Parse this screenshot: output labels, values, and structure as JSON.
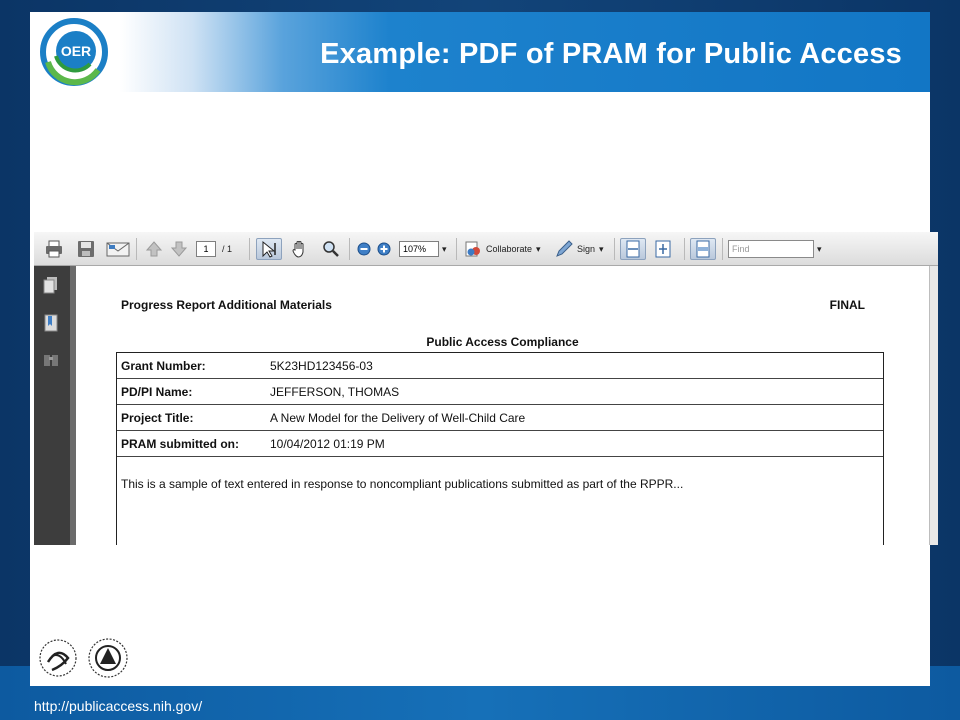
{
  "slide": {
    "title": "Example: PDF of PRAM for Public Access",
    "logo_text": "OER",
    "url": "http://publicaccess.nih.gov/"
  },
  "viewer": {
    "page_current": "1",
    "page_total": "/ 1",
    "zoom": "107%",
    "collaborate_label": "Collaborate",
    "sign_label": "Sign",
    "find_placeholder": "Find",
    "icons": [
      "print-icon",
      "save-icon",
      "email-icon",
      "prev-page-icon",
      "next-page-icon",
      "select-tool-icon",
      "hand-tool-icon",
      "zoom-tool-icon",
      "zoom-out-icon",
      "zoom-in-icon",
      "collaborate-icon",
      "sign-pen-icon",
      "fit-width-icon",
      "fit-page-icon",
      "print-screen-icon"
    ]
  },
  "document": {
    "header_left": "Progress Report Additional Materials",
    "header_right": "FINAL",
    "subtitle": "Public Access Compliance",
    "rows": [
      {
        "label": "Grant Number:",
        "value": "5K23HD123456-03"
      },
      {
        "label": "PD/PI Name:",
        "value": "JEFFERSON, THOMAS"
      },
      {
        "label": "Project Title:",
        "value": "A New Model for the Delivery of Well-Child Care"
      },
      {
        "label": "PRAM submitted on:",
        "value": "10/04/2012 01:19 PM"
      }
    ],
    "body_text": "This is a sample of text entered in response to noncompliant publications submitted as part of the RPPR..."
  },
  "colors": {
    "header_blue": "#1276c5",
    "frame_navy": "#0b3566",
    "band_blue": "#1670b8"
  }
}
